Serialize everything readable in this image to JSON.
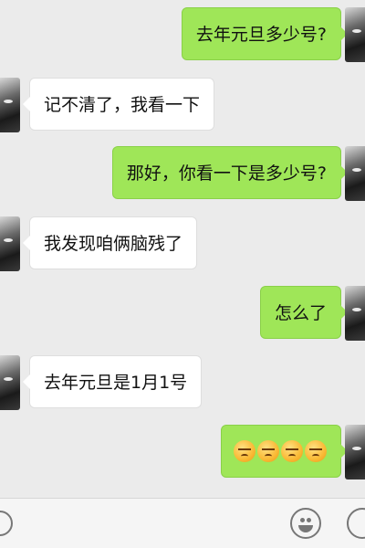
{
  "messages": [
    {
      "side": "right",
      "text": "去年元旦多少号?"
    },
    {
      "side": "left",
      "text": "记不清了，我看一下"
    },
    {
      "side": "right",
      "text": "那好，你看一下是多少号?"
    },
    {
      "side": "left",
      "text": "我发现咱俩脑残了"
    },
    {
      "side": "right",
      "text": "怎么了"
    },
    {
      "side": "left",
      "text": "去年元旦是1月1号"
    },
    {
      "side": "right",
      "emoji": "unamused-face",
      "count": 4
    }
  ],
  "colors": {
    "sent_bubble": "#9fe658",
    "received_bubble": "#ffffff",
    "background": "#ebebeb"
  },
  "input_bar": {
    "icons": [
      "voice-icon",
      "emoji-icon",
      "plus-icon"
    ]
  }
}
